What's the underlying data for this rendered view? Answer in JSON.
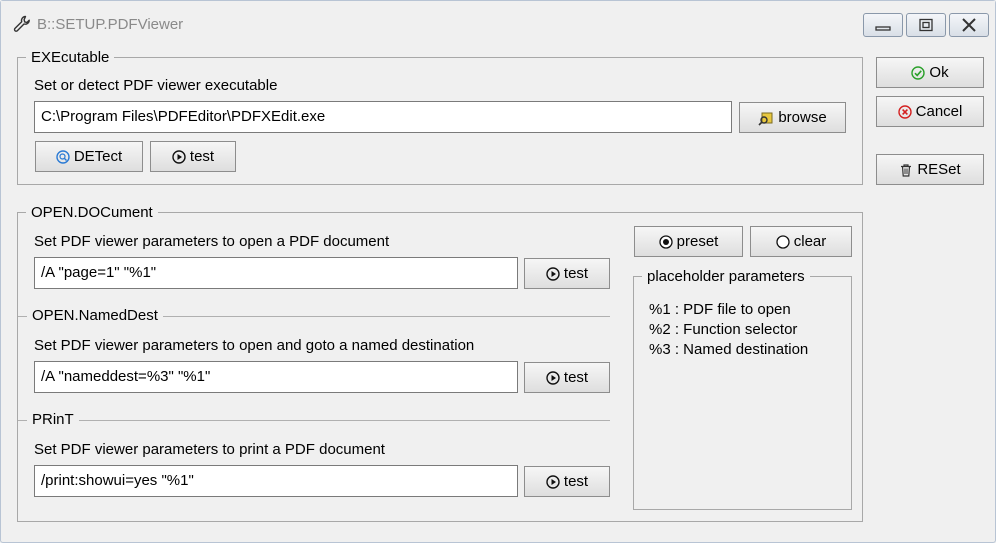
{
  "window": {
    "title": "B::SETUP.PDFViewer"
  },
  "executable": {
    "legend": "EXEcutable",
    "description": "Set or detect PDF viewer executable",
    "path_value": "C:\\Program Files\\PDFEditor\\PDFXEdit.exe",
    "browse_label": "browse",
    "detect_label": "DETect",
    "test_label": "test"
  },
  "open_document": {
    "legend": "OPEN.DOCument",
    "description": "Set PDF viewer parameters to open a PDF document",
    "param_value": "/A \"page=1\" \"%1\"",
    "test_label": "test"
  },
  "open_named_dest": {
    "legend": "OPEN.NamedDest",
    "description": "Set PDF viewer parameters to open and goto a named destination",
    "param_value": "/A \"nameddest=%3\" \"%1\"",
    "test_label": "test"
  },
  "print": {
    "legend": "PRinT",
    "description": "Set PDF viewer parameters to print a PDF document",
    "param_value": "/print:showui=yes \"%1\"",
    "test_label": "test"
  },
  "preset_label": "preset",
  "clear_label": "clear",
  "placeholders": {
    "legend": "placeholder parameters",
    "lines": [
      "%1 : PDF file to open",
      "%2 : Function selector",
      "%3 : Named destination"
    ]
  },
  "side_buttons": {
    "ok": "Ok",
    "cancel": "Cancel",
    "reset": "RESet"
  },
  "colors": {
    "ok_icon": "#2aa02a",
    "cancel_icon": "#d42020",
    "detect_icon": "#2a7ad4"
  }
}
